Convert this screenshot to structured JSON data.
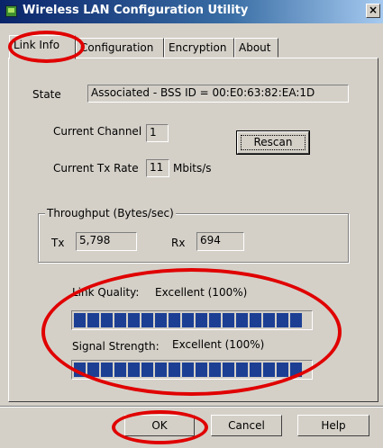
{
  "window": {
    "title": "Wireless LAN Configuration Utility",
    "close": "×"
  },
  "tabs": [
    {
      "label": "Link Info"
    },
    {
      "label": "Configuration"
    },
    {
      "label": "Encryption"
    },
    {
      "label": "About"
    }
  ],
  "link_info": {
    "state_label": "State",
    "state_value": "Associated - BSS ID = 00:E0:63:82:EA:1D",
    "channel_label": "Current Channel",
    "channel_value": "1",
    "txrate_label": "Current Tx Rate",
    "txrate_value": "11",
    "txrate_unit": "Mbits/s",
    "rescan_button": "Rescan",
    "throughput": {
      "title": "Throughput (Bytes/sec)",
      "tx_label": "Tx",
      "tx_value": "5,798",
      "rx_label": "Rx",
      "rx_value": "694"
    },
    "link_quality": {
      "label": "Link Quality:",
      "value": "Excellent (100%)",
      "percent": 100
    },
    "signal_strength": {
      "label": "Signal Strength:",
      "value": "Excellent (100%)",
      "percent": 100
    }
  },
  "footer": {
    "ok": "OK",
    "cancel": "Cancel",
    "help": "Help"
  },
  "colors": {
    "annotation": "#e00000",
    "bar_fill": "#1c3f94",
    "title_bar": "#0a246a"
  }
}
